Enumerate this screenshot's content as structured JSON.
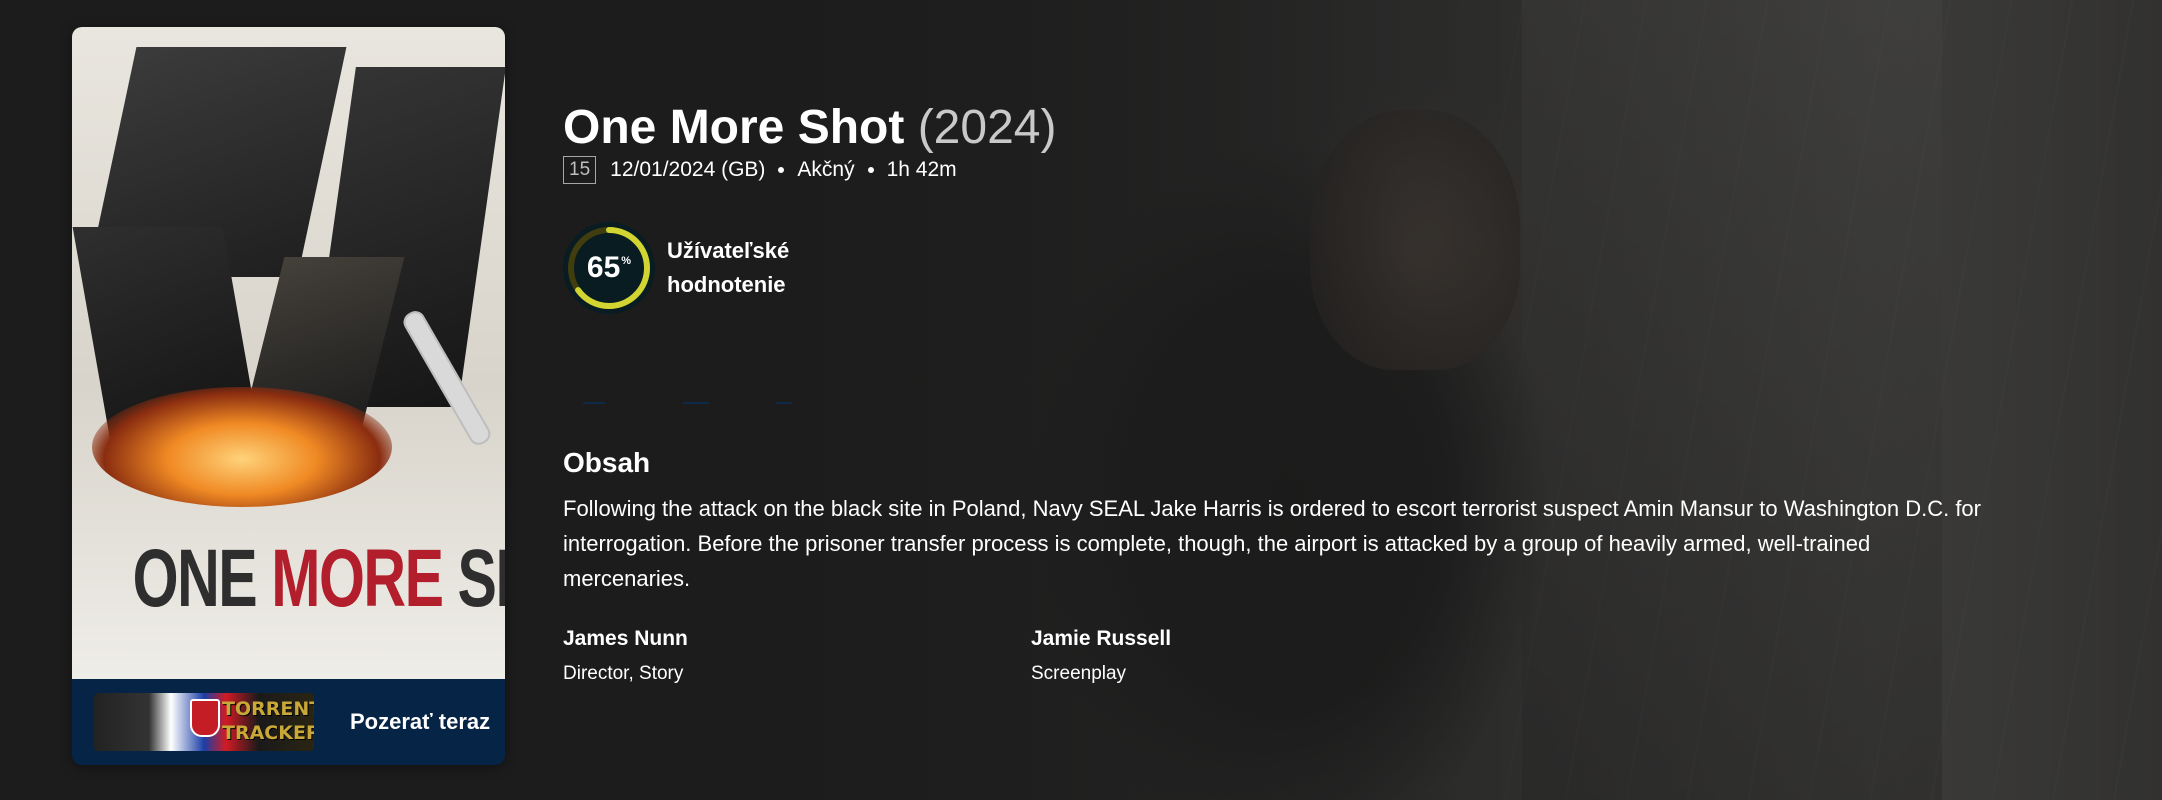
{
  "poster": {
    "title_parts": [
      "ONE ",
      "MORE",
      " SHOT"
    ],
    "watch_label": "Pozerať teraz",
    "provider_logo_text": "TORRENT TRACKER"
  },
  "movie": {
    "title": "One More Shot",
    "year": "(2024)",
    "certification": "15",
    "release": "12/01/2024 (GB)",
    "genre": "Akčný",
    "runtime": "1h 42m"
  },
  "score": {
    "value": "65",
    "percent_symbol": "%",
    "fraction": 0.65,
    "label": "Užívateľské hodnotenie",
    "ring_color": "#d2d531",
    "track_color": "#423d0f"
  },
  "overview": {
    "heading": "Obsah",
    "text": "Following the attack on the black site in Poland, Navy SEAL Jake Harris is ordered to escort terrorist suspect Amin Mansur to Washington D.C. for interrogation. Before the prisoner transfer process is complete, though, the airport is attacked by a group of heavily armed, well-trained mercenaries."
  },
  "crew": [
    {
      "name": "James Nunn",
      "job": "Director, Story"
    },
    {
      "name": "Jamie Russell",
      "job": "Screenplay"
    }
  ]
}
